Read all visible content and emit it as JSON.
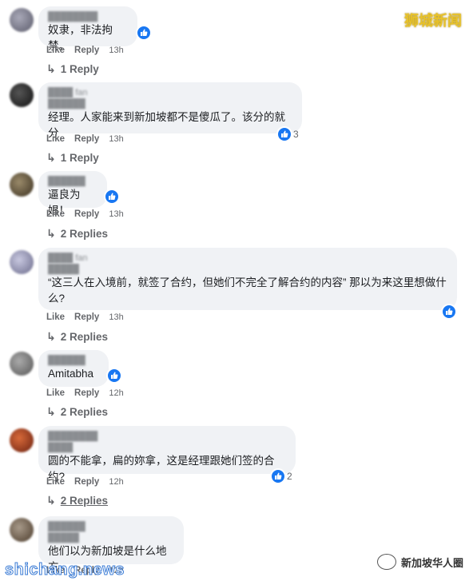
{
  "brand": "狮城新闻",
  "comments": [
    {
      "text": "奴隶，非法拘禁。",
      "like": "Like",
      "reply": "Reply",
      "time": "13h",
      "replies": "1 Reply",
      "count": ""
    },
    {
      "text": "经理。人家能来到新加坡都不是傻瓜了。该分的就分",
      "like": "Like",
      "reply": "Reply",
      "time": "13h",
      "replies": "1 Reply",
      "count": "3",
      "name": "fan"
    },
    {
      "text": "逼良为娼！",
      "like": "Like",
      "reply": "Reply",
      "time": "13h",
      "replies": "2 Replies",
      "count": ""
    },
    {
      "text": "“这三人在入境前，就签了合约，但她们不完全了解合约的内容” 那以为来这里想做什\n么?",
      "like": "Like",
      "reply": "Reply",
      "time": "13h",
      "replies": "2 Replies",
      "count": "",
      "name": "fan"
    },
    {
      "text": "Amitabha",
      "like": "Like",
      "reply": "Reply",
      "time": "12h",
      "replies": "2 Replies",
      "count": ""
    },
    {
      "text": "圆的不能拿，扁的妳拿，这是经理跟她们签的合约?",
      "like": "Like",
      "reply": "Reply",
      "time": "12h",
      "replies": "2 Replies",
      "count": "2"
    },
    {
      "text": "他们以为新加坡是什么地方",
      "like": "Like",
      "reply": "Reply",
      "time": "12h",
      "replies": "",
      "count": ""
    }
  ],
  "watermark_left": "shichang.news",
  "watermark_right": "新加坡华人圈",
  "colors": {
    "accent": "#1877f2",
    "bubble": "#f0f2f5",
    "muted": "#65676b"
  }
}
